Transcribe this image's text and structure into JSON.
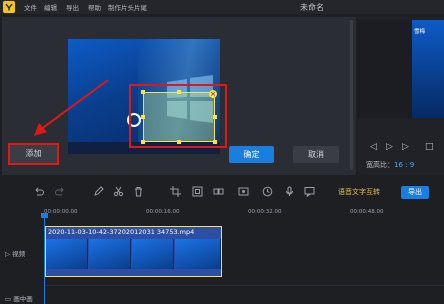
{
  "app": {
    "title": "未命名",
    "menu": [
      "文件",
      "编辑",
      "导出",
      "帮助",
      "制作片头片尾"
    ]
  },
  "editor": {
    "add_label": "添加",
    "confirm_label": "确定",
    "cancel_label": "取消"
  },
  "right_panel": {
    "watermark_text": "雪梅",
    "aspect_label": "宽高比：",
    "aspect_value": "16 : 9"
  },
  "toolbar": {
    "tools": [
      "undo-icon",
      "redo-icon",
      "pen-icon",
      "scissors-icon",
      "trash-icon",
      "crop-icon",
      "fit-icon",
      "split-icon",
      "freeze-icon",
      "timer-icon",
      "mic-icon",
      "speech-icon"
    ],
    "voice_text_label": "语音文字互转",
    "export_label": "导出"
  },
  "timeline": {
    "ticks": [
      "00:00:00.00",
      "00:00:16.00",
      "00:00:32.00",
      "00:00:48.00"
    ],
    "tracks": [
      "视频",
      "画中画"
    ],
    "clip_name": "2020-11-03-10-42-37202012031 34753.mp4"
  },
  "colors": {
    "accent": "#1a7de0",
    "highlight": "#e01818",
    "selection": "#ffe14a"
  }
}
